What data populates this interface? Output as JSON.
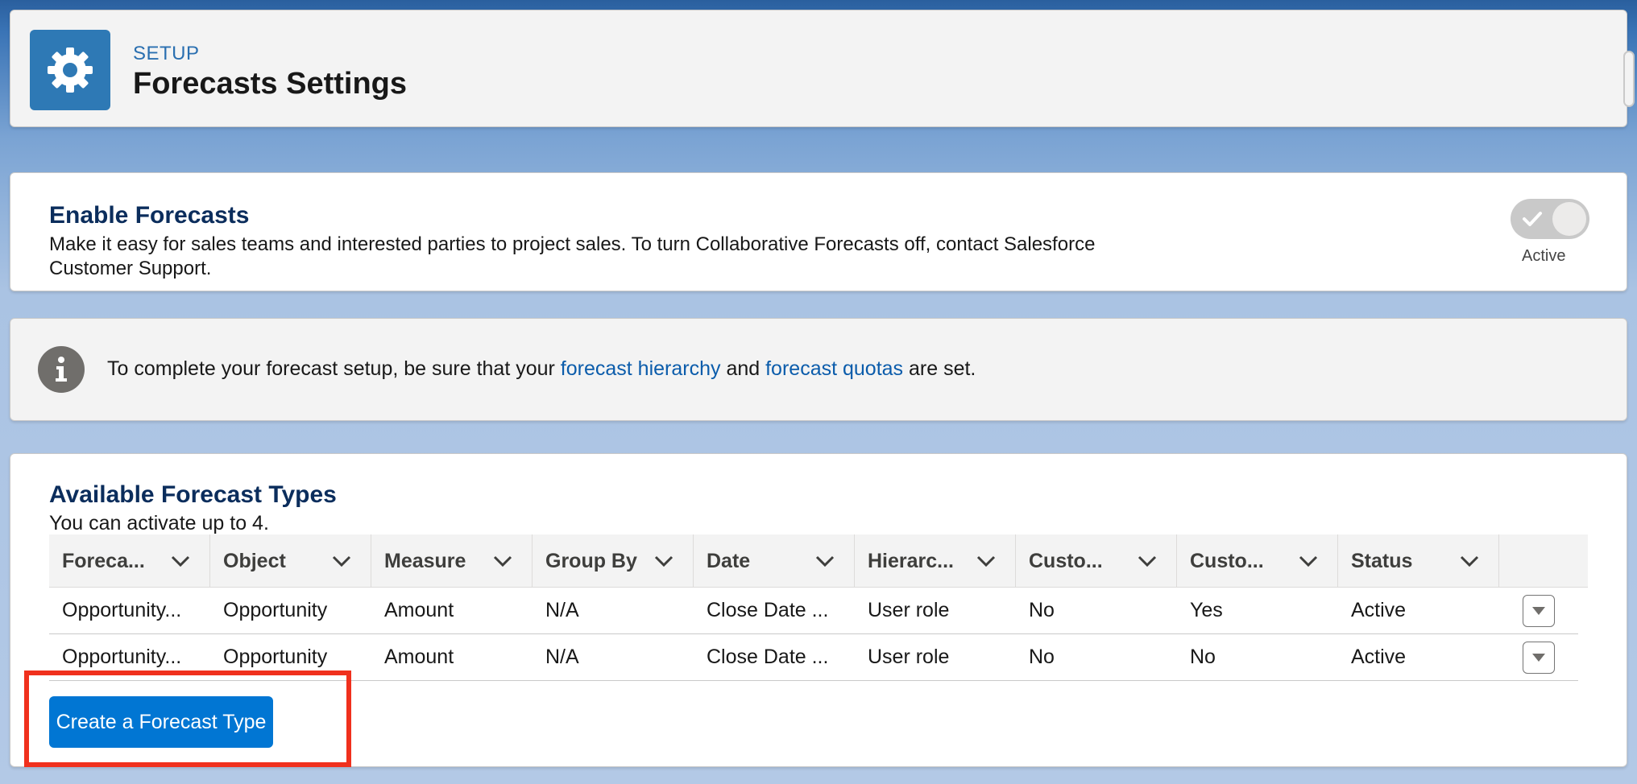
{
  "header": {
    "setup_label": "SETUP",
    "title": "Forecasts Settings",
    "icon": "gear-icon"
  },
  "enable": {
    "title": "Enable Forecasts",
    "description": "Make it easy for sales teams and interested parties to project sales. To turn Collaborative Forecasts off, contact Salesforce Customer Support.",
    "toggle_label": "Active"
  },
  "info": {
    "text_before": "To complete your forecast setup, be sure that your ",
    "link_hierarchy": "forecast hierarchy",
    "text_middle": " and ",
    "link_quotas": "forecast quotas",
    "text_after": " are set."
  },
  "types": {
    "title": "Available Forecast Types",
    "subtitle": "You can activate up to 4.",
    "columns": [
      "Foreca...",
      "Object",
      "Measure",
      "Group By",
      "Date",
      "Hierarc...",
      "Custo...",
      "Custo...",
      "Status"
    ],
    "rows": [
      [
        "Opportunity...",
        "Opportunity",
        "Amount",
        "N/A",
        "Close Date ...",
        "User role",
        "No",
        "Yes",
        "Active"
      ],
      [
        "Opportunity...",
        "Opportunity",
        "Amount",
        "N/A",
        "Close Date ...",
        "User role",
        "No",
        "No",
        "Active"
      ]
    ],
    "create_button": "Create a Forecast Type"
  },
  "colors": {
    "brand_blue": "#0176d3",
    "title_navy": "#0b2d5c",
    "highlight_red": "#f0301d"
  }
}
